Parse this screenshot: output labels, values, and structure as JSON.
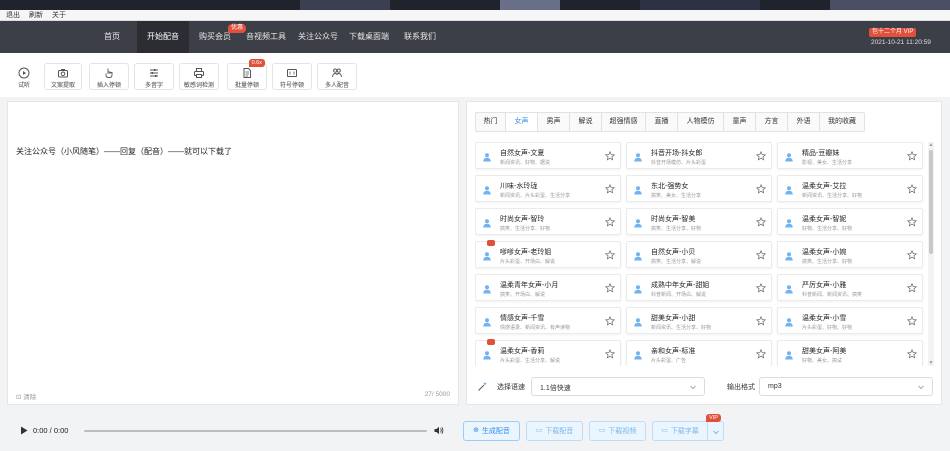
{
  "menu": [
    "退出",
    "刷新",
    "关于"
  ],
  "nav": {
    "items": [
      {
        "label": "首页",
        "active": false
      },
      {
        "label": "开始配音",
        "active": true
      },
      {
        "label": "购买会员",
        "active": false,
        "badge": "优惠"
      },
      {
        "label": "音视频工具",
        "active": false
      },
      {
        "label": "关注公众号",
        "active": false
      },
      {
        "label": "下载桌面端",
        "active": false
      },
      {
        "label": "联系我们",
        "active": false
      }
    ],
    "vip_badge": "包十二个月 VIP",
    "datetime": "2021-10-21 11:20:59"
  },
  "toolbar": [
    {
      "label": "试听",
      "icon": "play-circle-icon"
    },
    {
      "label": "文案提取",
      "icon": "camera-icon"
    },
    {
      "label": "插入停顿",
      "icon": "hand-pointer-icon"
    },
    {
      "label": "多音字",
      "icon": "sliders-icon"
    },
    {
      "label": "敏感词检测",
      "icon": "printer-icon"
    },
    {
      "label": "批量停顿",
      "icon": "document-icon",
      "badge": "0.6x"
    },
    {
      "label": "符号停顿",
      "icon": "symbol-box-icon"
    },
    {
      "label": "多人配音",
      "icon": "users-icon"
    }
  ],
  "editor": {
    "text": "关注公众号（小风随笔）——回复（配音）——就可以下载了",
    "clear_label": "清除",
    "char_count": "27/ 5000"
  },
  "voice_tabs": [
    {
      "label": "热门",
      "active": false
    },
    {
      "label": "女声",
      "active": true
    },
    {
      "label": "男声",
      "active": false
    },
    {
      "label": "解说",
      "active": false
    },
    {
      "label": "超强情感",
      "active": false
    },
    {
      "label": "直播",
      "active": false
    },
    {
      "label": "人物模仿",
      "active": false
    },
    {
      "label": "童声",
      "active": false
    },
    {
      "label": "方言",
      "active": false
    },
    {
      "label": "外语",
      "active": false
    },
    {
      "label": "我的收藏",
      "active": false
    }
  ],
  "voices": [
    {
      "name": "自然女声-文夏",
      "tags": "新闻资讯、好物、据说"
    },
    {
      "name": "抖音开场-抖女郎",
      "tags": "抖音开场模仿、片头彩蛋"
    },
    {
      "name": "精品-豆瓣妹",
      "tags": "影视、美女、生活分享"
    },
    {
      "name": "川味-水玲珑",
      "tags": "新闻资讯、片头彩蛋、生活分享"
    },
    {
      "name": "东北-强势女",
      "tags": "搞笑、美女、生活分享"
    },
    {
      "name": "温柔女声-艾拉",
      "tags": "新闻资讯、生活分享、好物"
    },
    {
      "name": "时尚女声-智玲",
      "tags": "搞笑、生活分享、好物"
    },
    {
      "name": "时尚女声-智美",
      "tags": "搞笑、生活分享、好物"
    },
    {
      "name": "温柔女声-智妮",
      "tags": "好物、生活分享、好物"
    },
    {
      "name": "嗲嗲女声-老玲姐",
      "tags": "片头彩蛋、开场白、解说",
      "hot": true
    },
    {
      "name": "自然女声-小贝",
      "tags": "搞笑、生活分享、解说"
    },
    {
      "name": "温柔女声-小婉",
      "tags": "搞笑、生活分享、好物"
    },
    {
      "name": "温柔青年女声-小月",
      "tags": "搞笑、开场白、解说"
    },
    {
      "name": "成熟中年女声-甜姐",
      "tags": "科普新闻、开场白、解说"
    },
    {
      "name": "严厉女声-小雅",
      "tags": "科普新闻、新闻资讯、搞笑"
    },
    {
      "name": "情感女声-千雪",
      "tags": "情感语录、新闻资讯、有声读物"
    },
    {
      "name": "甜美女声-小甜",
      "tags": "新闻资讯、生活分享、好物"
    },
    {
      "name": "温柔女声-小雪",
      "tags": "片头彩蛋、好物、好物"
    },
    {
      "name": "温柔女声-香莉",
      "tags": "片头彩蛋、生活分享、解说",
      "hot": true
    },
    {
      "name": "亲和女声-标准",
      "tags": "片头彩蛋、广告"
    },
    {
      "name": "甜美女声-阿美",
      "tags": "好物、美女、搞试"
    }
  ],
  "options": {
    "speed_label": "选择语速",
    "speed_value": "1.1倍快速",
    "format_label": "输出格式",
    "format_value": "mp3"
  },
  "player": {
    "time": "0:00 / 0:00"
  },
  "actions": {
    "generate": "生成配音",
    "download_audio": "下载配音",
    "download_video": "下载视频",
    "download_subtitle": "下载字幕",
    "vip": "VIP"
  },
  "colors": {
    "nav_bg": "#3c3f47",
    "nav_active_bg": "#2b2d33",
    "accent": "#2f8ff0",
    "badge_red": "#e0503a"
  }
}
